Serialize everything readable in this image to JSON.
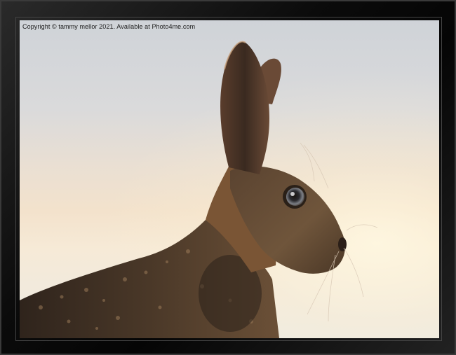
{
  "photo": {
    "copyright_text": "Copyright © tammy mellor 2021. Available at Photo4me.com",
    "subject": "hare-profile"
  },
  "colors": {
    "frame": "#0b0b0b",
    "sky_top": "#cfd3d8",
    "sky_glow": "#f6ead7",
    "fur_dark": "#3b2a1f",
    "fur_mid": "#6b4f38",
    "fur_light": "#a07c58"
  }
}
